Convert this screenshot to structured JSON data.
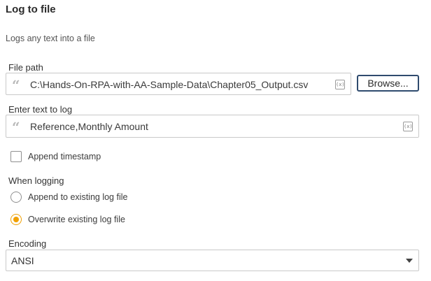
{
  "panel": {
    "title": "Log to file",
    "description": "Logs any text into a file"
  },
  "file_path": {
    "label": "File path",
    "value": "C:\\Hands-On-RPA-with-AA-Sample-Data\\Chapter05_Output.csv",
    "variable_icon": "(x)",
    "browse_label": "Browse..."
  },
  "text_to_log": {
    "label": "Enter text to log",
    "value": "Reference,Monthly Amount",
    "variable_icon": "(x)"
  },
  "append_timestamp": {
    "label": "Append timestamp",
    "checked": false
  },
  "when_logging": {
    "label": "When logging",
    "options": [
      {
        "label": "Append to existing log file",
        "selected": false
      },
      {
        "label": "Overwrite existing log file",
        "selected": true
      }
    ],
    "accent_color": "#f0a000"
  },
  "encoding": {
    "label": "Encoding",
    "selected": "ANSI"
  },
  "icons": {
    "quote": "quote-icon",
    "variable": "variable-icon",
    "dropdown": "chevron-down-icon"
  }
}
